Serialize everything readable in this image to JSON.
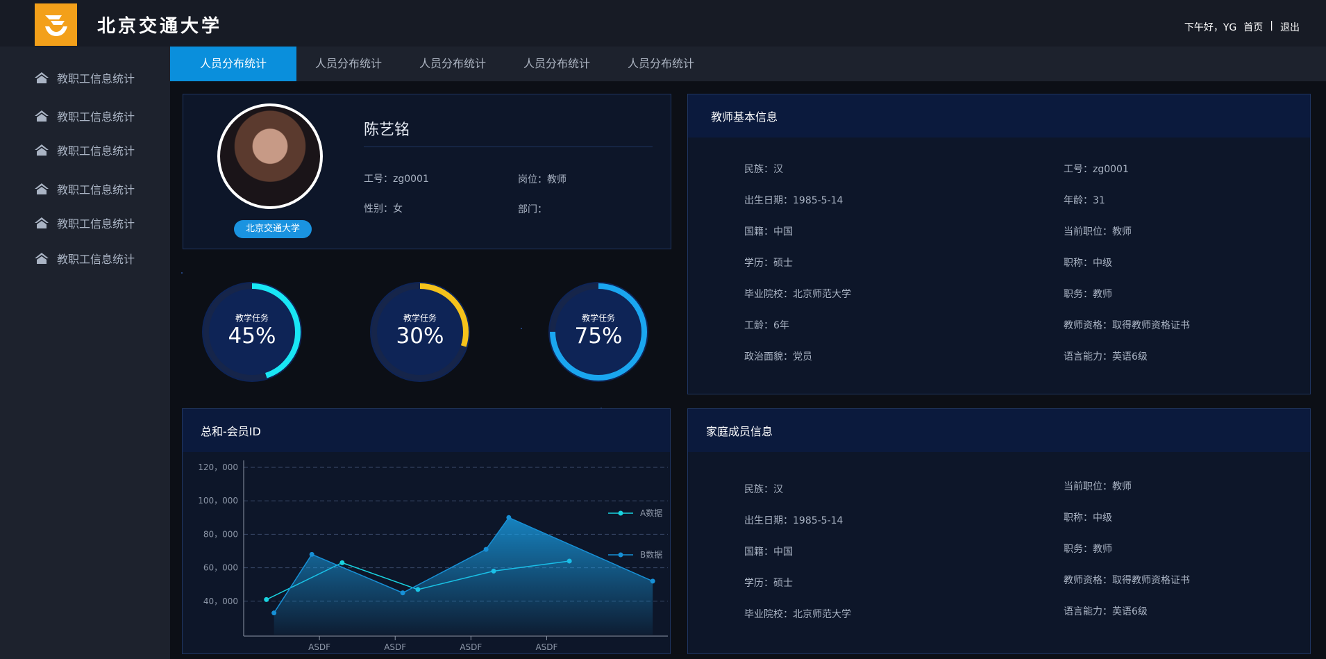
{
  "header": {
    "university_name": "北京交通大学",
    "greeting": "下午好，YG",
    "home_link": "首页",
    "separator": "|",
    "logout_link": "退出"
  },
  "sidebar": {
    "items": [
      {
        "label": "教职工信息统计"
      },
      {
        "label": "教职工信息统计"
      },
      {
        "label": "教职工信息统计"
      },
      {
        "label": "教职工信息统计"
      },
      {
        "label": "教职工信息统计"
      },
      {
        "label": "教职工信息统计"
      }
    ]
  },
  "tabs": [
    {
      "label": "人员分布统计",
      "active": true
    },
    {
      "label": "人员分布统计",
      "active": false
    },
    {
      "label": "人员分布统计",
      "active": false
    },
    {
      "label": "人员分布统计",
      "active": false
    },
    {
      "label": "人员分布统计",
      "active": false
    }
  ],
  "profile": {
    "name": "陈艺铭",
    "school_badge": "北京交通大学",
    "employee_id": "工号：zg0001",
    "position": "岗位：教师",
    "gender": "性别：女",
    "department": "部门："
  },
  "gauges": [
    {
      "label": "教学任务",
      "value_text": "45%",
      "value": 0.45,
      "color": "#19e6f5"
    },
    {
      "label": "教学任务",
      "value_text": "30%",
      "value": 0.3,
      "color": "#f5c21b"
    },
    {
      "label": "教学任务",
      "value_text": "75%",
      "value": 0.75,
      "color": "#1aa6f0"
    }
  ],
  "teacher_info": {
    "title": "教师基本信息",
    "left": [
      "民族：汉",
      "出生日期：1985-5-14",
      "国籍：中国",
      "学历：硕士",
      "毕业院校：北京师范大学",
      "工龄：6年",
      "政治面貌：党员"
    ],
    "right": [
      "工号：zg0001",
      "年龄：31",
      "当前职位：教师",
      "职称：中级",
      "职务：教师",
      "教师资格：取得教师资格证书",
      "语言能力：英语6级"
    ]
  },
  "family_info": {
    "title": "家庭成员信息",
    "left": [
      "民族：汉",
      "出生日期：1985-5-14",
      "国籍：中国",
      "学历：硕士",
      "毕业院校：北京师范大学"
    ],
    "right": [
      "当前职位：教师",
      "职称：中级",
      "职务：教师",
      "教师资格：取得教师资格证书",
      "语言能力：英语6级"
    ]
  },
  "chart_panel": {
    "title": "总和-会员ID"
  },
  "chart_data": {
    "type": "line",
    "x_tick_labels": [
      "ASDF",
      "ASDF",
      "ASDF",
      "ASDF"
    ],
    "y_tick_labels": [
      "120，000",
      "100，000",
      "80，000",
      "60，000",
      "40，000"
    ],
    "ylim": [
      20000,
      120000
    ],
    "grid": true,
    "legend_position": "right",
    "series": [
      {
        "name": "A数据",
        "color": "#19d3e0",
        "area": false,
        "points": [
          [
            0.3,
            41000
          ],
          [
            1.3,
            63000
          ],
          [
            2.3,
            47000
          ],
          [
            3.3,
            58000
          ],
          [
            4.3,
            64000
          ]
        ]
      },
      {
        "name": "B数据",
        "color": "#1790d6",
        "area": true,
        "points": [
          [
            0.4,
            33000
          ],
          [
            0.9,
            68000
          ],
          [
            2.1,
            45000
          ],
          [
            3.2,
            71000
          ],
          [
            3.5,
            90000
          ],
          [
            5.4,
            52000
          ]
        ]
      }
    ]
  }
}
